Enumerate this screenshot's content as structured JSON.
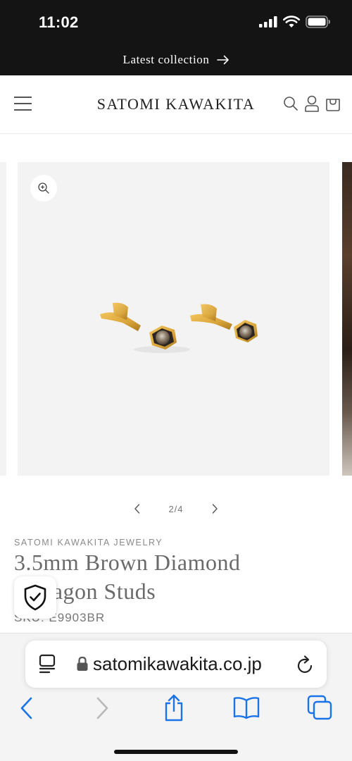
{
  "status_bar": {
    "time": "11:02"
  },
  "announcement": {
    "text": "Latest collection"
  },
  "header": {
    "logo": "SATOMI KAWAKITA"
  },
  "gallery": {
    "counter": "2/4"
  },
  "product": {
    "vendor": "SATOMI KAWAKITA JEWELRY",
    "title": "3.5mm Brown Diamond Hexagon Studs",
    "sku": "SKU: E9903BR"
  },
  "browser": {
    "url": "satomikawakita.co.jp"
  },
  "colors": {
    "ios_blue": "#1a73e8",
    "bar_dark": "#141414",
    "gold": "#d9a43a"
  }
}
